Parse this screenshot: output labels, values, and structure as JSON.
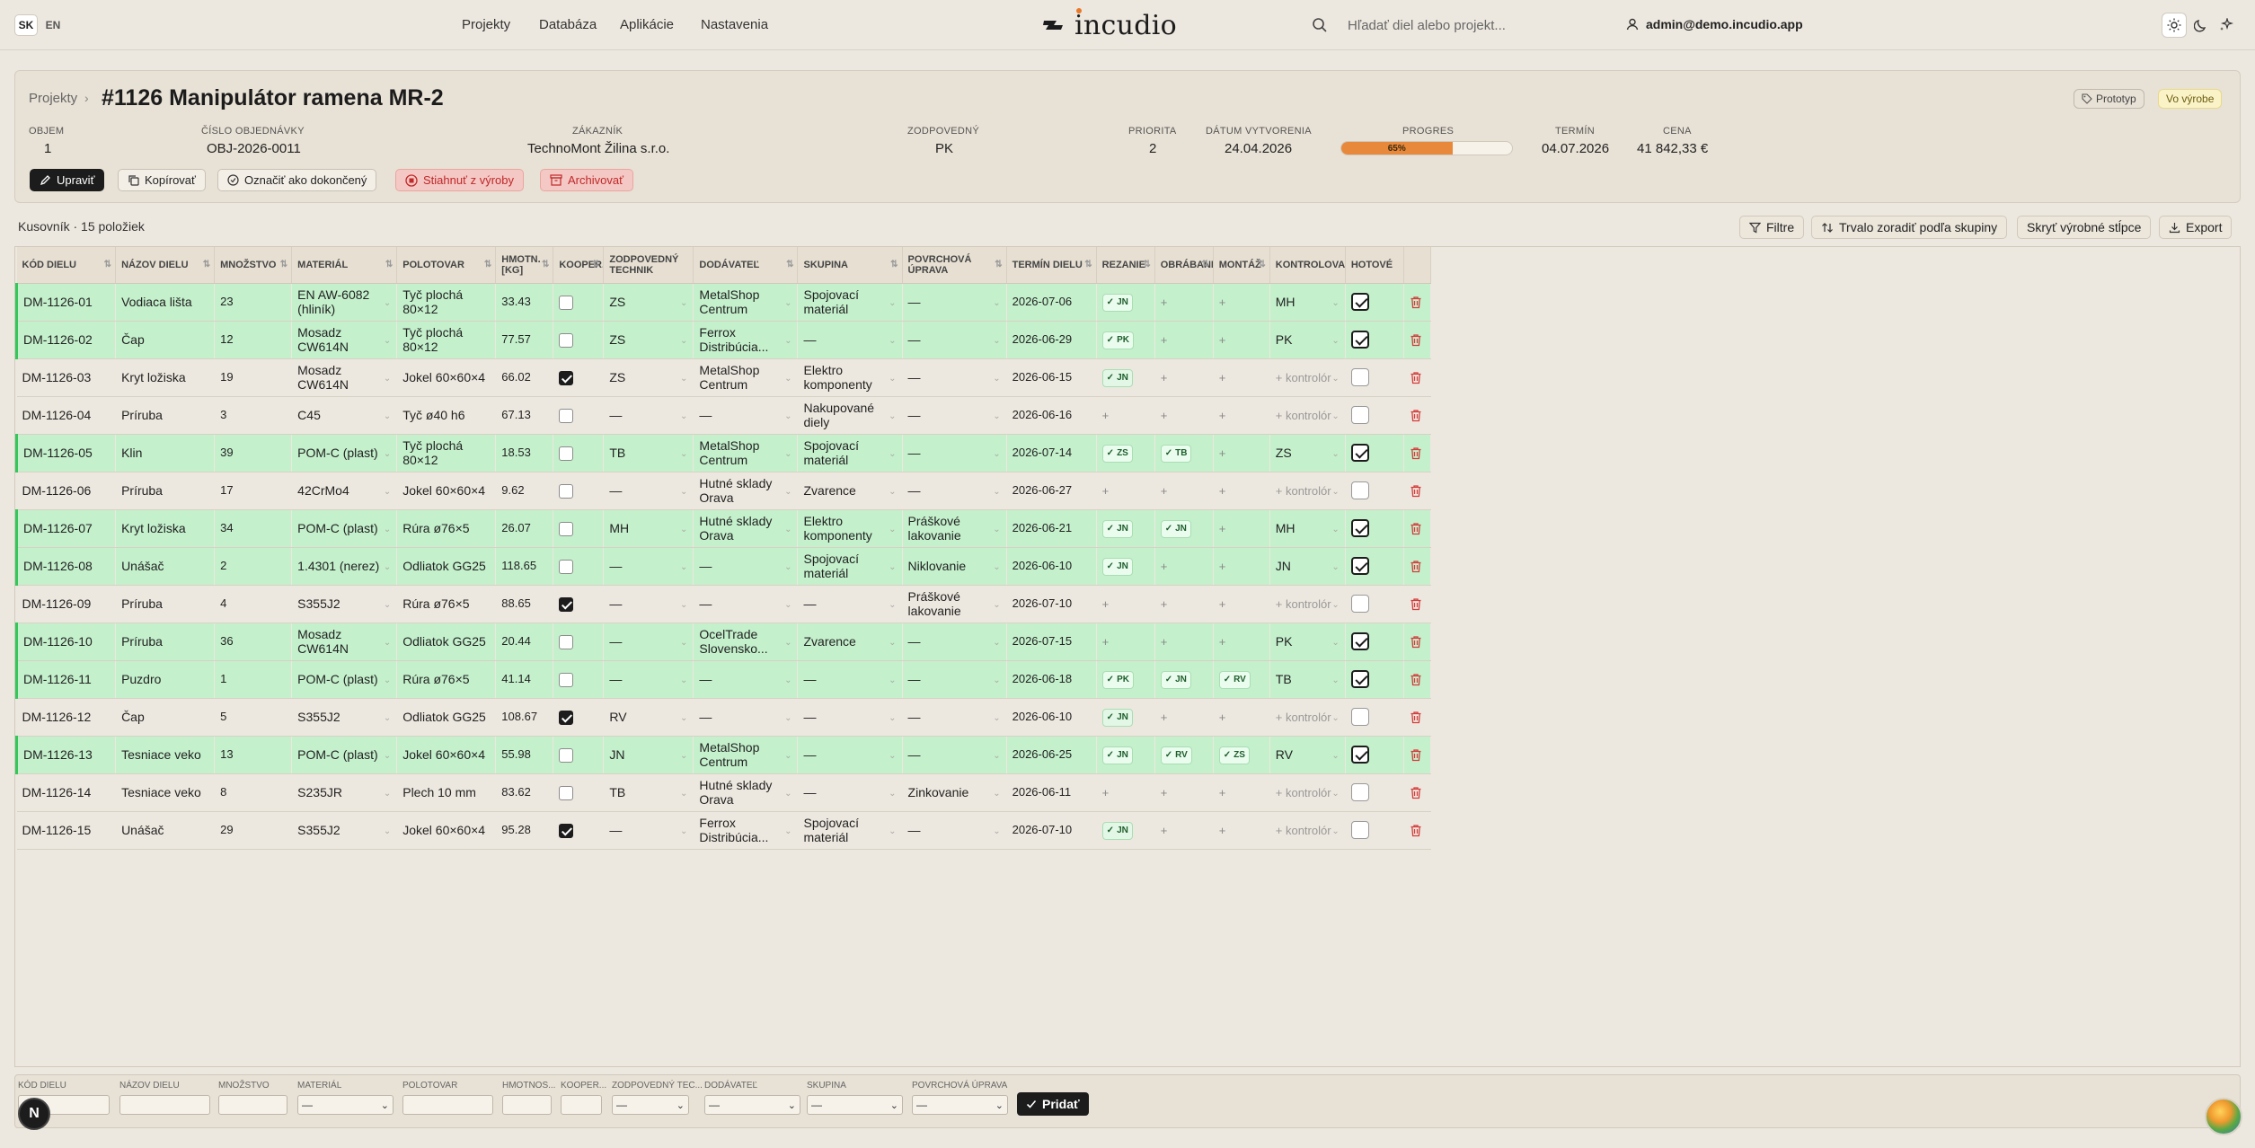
{
  "header": {
    "lang_sk": "SK",
    "lang_en": "EN",
    "nav": [
      "Projekty",
      "Databáza",
      "Aplikácie",
      "Nastavenia"
    ],
    "logo": "incudio",
    "search_placeholder": "Hľadať diel alebo projekt...",
    "user_email": "admin@demo.incudio.app"
  },
  "project": {
    "breadcrumb": "Projekty",
    "title": "#1126 Manipulátor ramena MR-2",
    "tags": [
      "Prototyp",
      "Vo výrobe"
    ],
    "fields": [
      {
        "label": "OBJEM",
        "value": "1"
      },
      {
        "label": "ČÍSLO OBJEDNÁVKY",
        "value": "OBJ-2026-0011"
      },
      {
        "label": "ZÁKAZNÍK",
        "value": "TechnoMont Žilina s.r.o."
      },
      {
        "label": "ZODPOVEDNÝ",
        "value": "PK"
      },
      {
        "label": "PRIORITA",
        "value": "2"
      },
      {
        "label": "DÁTUM VYTVORENIA",
        "value": "24.04.2026"
      },
      {
        "label": "PROGRES",
        "value": "65%"
      },
      {
        "label": "TERMÍN",
        "value": "04.07.2026"
      },
      {
        "label": "CENA",
        "value": "41 842,33 €"
      }
    ],
    "progress": 0.65,
    "actions": [
      "Upraviť",
      "Kopírovať",
      "Označiť ako dokončený",
      "Stiahnuť z výroby",
      "Archivovať"
    ]
  },
  "bom": {
    "title": "Kusovník · 15 položiek",
    "toolbar": [
      "Filtre",
      "Trvalo zoradiť podľa skupiny",
      "Skryť výrobné stĺpce",
      "Export"
    ],
    "columns": [
      "KÓD DIELU",
      "NÁZOV DIELU",
      "MNOŽSTVO",
      "MATERIÁL",
      "POLOTOVAR",
      "HMOTN. [KG]",
      "KOOPER.",
      "ZODPOVEDNÝ TECHNIK",
      "DODÁVATEĽ",
      "SKUPINA",
      "POVRCHOVÁ ÚPRAVA",
      "TERMÍN DIELU",
      "REZANIE",
      "OBRÁBANIE",
      "MONTÁŽ",
      "KONTROLOVAL",
      "HOTOVÉ"
    ],
    "control_placeholder": "+ kontrolór",
    "rows": [
      {
        "code": "DM-1126-01",
        "name": "Vodiaca lišta",
        "qty": "23",
        "material": "EN AW-6082 (hliník)",
        "semi": "Tyč plochá 80×12",
        "weight": "33.43",
        "coop": false,
        "tech": "ZS",
        "supplier": "MetalShop Centrum",
        "group": "Spojovací materiál",
        "surface": "—",
        "date": "2026-07-06",
        "rez": "JN",
        "obr": "",
        "mon": "",
        "ctrl": "MH",
        "done": true
      },
      {
        "code": "DM-1126-02",
        "name": "Čap",
        "qty": "12",
        "material": "Mosadz CW614N",
        "semi": "Tyč plochá 80×12",
        "weight": "77.57",
        "coop": false,
        "tech": "ZS",
        "supplier": "Ferrox Distribúcia...",
        "group": "—",
        "surface": "—",
        "date": "2026-06-29",
        "rez": "PK",
        "obr": "",
        "mon": "",
        "ctrl": "PK",
        "done": true
      },
      {
        "code": "DM-1126-03",
        "name": "Kryt ložiska",
        "qty": "19",
        "material": "Mosadz CW614N",
        "semi": "Jokel 60×60×4",
        "weight": "66.02",
        "coop": true,
        "tech": "ZS",
        "supplier": "MetalShop Centrum",
        "group": "Elektro komponenty",
        "surface": "—",
        "date": "2026-06-15",
        "rez": "JN",
        "obr": "",
        "mon": "",
        "ctrl": "",
        "done": false
      },
      {
        "code": "DM-1126-04",
        "name": "Príruba",
        "qty": "3",
        "material": "C45",
        "semi": "Tyč ø40 h6",
        "weight": "67.13",
        "coop": false,
        "tech": "—",
        "supplier": "—",
        "group": "Nakupované diely",
        "surface": "—",
        "date": "2026-06-16",
        "rez": "",
        "obr": "",
        "mon": "",
        "ctrl": "",
        "done": false
      },
      {
        "code": "DM-1126-05",
        "name": "Klin",
        "qty": "39",
        "material": "POM-C (plast)",
        "semi": "Tyč plochá 80×12",
        "weight": "18.53",
        "coop": false,
        "tech": "TB",
        "supplier": "MetalShop Centrum",
        "group": "Spojovací materiál",
        "surface": "—",
        "date": "2026-07-14",
        "rez": "ZS",
        "obr": "TB",
        "mon": "",
        "ctrl": "ZS",
        "done": true
      },
      {
        "code": "DM-1126-06",
        "name": "Príruba",
        "qty": "17",
        "material": "42CrMo4",
        "semi": "Jokel 60×60×4",
        "weight": "9.62",
        "coop": false,
        "tech": "—",
        "supplier": "Hutné sklady Orava",
        "group": "Zvarence",
        "surface": "—",
        "date": "2026-06-27",
        "rez": "",
        "obr": "",
        "mon": "",
        "ctrl": "",
        "done": false
      },
      {
        "code": "DM-1126-07",
        "name": "Kryt ložiska",
        "qty": "34",
        "material": "POM-C (plast)",
        "semi": "Rúra ø76×5",
        "weight": "26.07",
        "coop": false,
        "tech": "MH",
        "supplier": "Hutné sklady Orava",
        "group": "Elektro komponenty",
        "surface": "Práškové lakovanie",
        "date": "2026-06-21",
        "rez": "JN",
        "obr": "JN",
        "mon": "",
        "ctrl": "MH",
        "done": true
      },
      {
        "code": "DM-1126-08",
        "name": "Unášač",
        "qty": "2",
        "material": "1.4301 (nerez)",
        "semi": "Odliatok GG25",
        "weight": "118.65",
        "coop": false,
        "tech": "—",
        "supplier": "—",
        "group": "Spojovací materiál",
        "surface": "Niklovanie",
        "date": "2026-06-10",
        "rez": "JN",
        "obr": "",
        "mon": "",
        "ctrl": "JN",
        "done": true
      },
      {
        "code": "DM-1126-09",
        "name": "Príruba",
        "qty": "4",
        "material": "S355J2",
        "semi": "Rúra ø76×5",
        "weight": "88.65",
        "coop": true,
        "tech": "—",
        "supplier": "—",
        "group": "—",
        "surface": "Práškové lakovanie",
        "date": "2026-07-10",
        "rez": "",
        "obr": "",
        "mon": "",
        "ctrl": "",
        "done": false
      },
      {
        "code": "DM-1126-10",
        "name": "Príruba",
        "qty": "36",
        "material": "Mosadz CW614N",
        "semi": "Odliatok GG25",
        "weight": "20.44",
        "coop": false,
        "tech": "—",
        "supplier": "OcelTrade Slovensko...",
        "group": "Zvarence",
        "surface": "—",
        "date": "2026-07-15",
        "rez": "",
        "obr": "",
        "mon": "",
        "ctrl": "PK",
        "done": true
      },
      {
        "code": "DM-1126-11",
        "name": "Puzdro",
        "qty": "1",
        "material": "POM-C (plast)",
        "semi": "Rúra ø76×5",
        "weight": "41.14",
        "coop": false,
        "tech": "—",
        "supplier": "—",
        "group": "—",
        "surface": "—",
        "date": "2026-06-18",
        "rez": "PK",
        "obr": "JN",
        "mon": "RV",
        "ctrl": "TB",
        "done": true
      },
      {
        "code": "DM-1126-12",
        "name": "Čap",
        "qty": "5",
        "material": "S355J2",
        "semi": "Odliatok GG25",
        "weight": "108.67",
        "coop": true,
        "tech": "RV",
        "supplier": "—",
        "group": "—",
        "surface": "—",
        "date": "2026-06-10",
        "rez": "JN",
        "obr": "",
        "mon": "",
        "ctrl": "",
        "done": false
      },
      {
        "code": "DM-1126-13",
        "name": "Tesniace veko",
        "qty": "13",
        "material": "POM-C (plast)",
        "semi": "Jokel 60×60×4",
        "weight": "55.98",
        "coop": false,
        "tech": "JN",
        "supplier": "MetalShop Centrum",
        "group": "—",
        "surface": "—",
        "date": "2026-06-25",
        "rez": "JN",
        "obr": "RV",
        "mon": "ZS",
        "ctrl": "RV",
        "done": true
      },
      {
        "code": "DM-1126-14",
        "name": "Tesniace veko",
        "qty": "8",
        "material": "S235JR",
        "semi": "Plech 10 mm",
        "weight": "83.62",
        "coop": false,
        "tech": "TB",
        "supplier": "Hutné sklady Orava",
        "group": "—",
        "surface": "Zinkovanie",
        "date": "2026-06-11",
        "rez": "",
        "obr": "",
        "mon": "",
        "ctrl": "",
        "done": false
      },
      {
        "code": "DM-1126-15",
        "name": "Unášač",
        "qty": "29",
        "material": "S355J2",
        "semi": "Jokel 60×60×4",
        "weight": "95.28",
        "coop": true,
        "tech": "—",
        "supplier": "Ferrox Distribúcia...",
        "group": "Spojovací materiál",
        "surface": "—",
        "date": "2026-07-10",
        "rez": "JN",
        "obr": "",
        "mon": "",
        "ctrl": "",
        "done": false
      }
    ]
  },
  "addbar": {
    "labels": [
      "KÓD DIELU",
      "NÁZOV DIELU",
      "MNOŽSTVO",
      "MATERIÁL",
      "POLOTOVAR",
      "HMOTNOS...",
      "KOOPER...",
      "ZODPOVEDNÝ TEC...",
      "DODÁVATEĽ",
      "SKUPINA",
      "POVRCHOVÁ ÚPRAVA"
    ],
    "select_value": "—",
    "add_label": "Pridať"
  },
  "badge": "N",
  "colors": {
    "done_row": "#c4f0cc",
    "accent": "#e8883a",
    "danger": "#d43c3c"
  }
}
